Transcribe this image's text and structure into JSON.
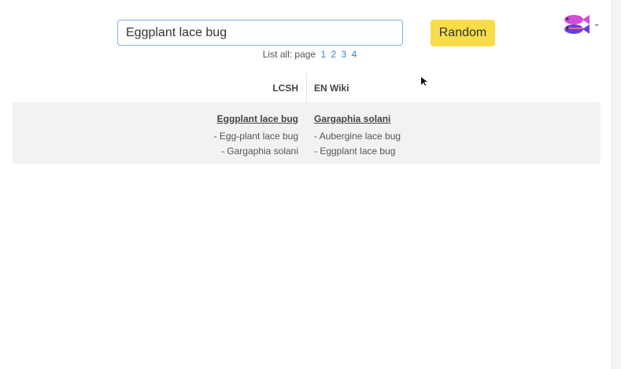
{
  "search": {
    "value": "Eggplant lace bug"
  },
  "random_button": "Random",
  "list_all": {
    "label": "List all: page",
    "pages": [
      "1",
      "2",
      "3",
      "4"
    ]
  },
  "table": {
    "headers": [
      "LCSH",
      "EN Wiki"
    ],
    "rows": [
      {
        "lcsh": {
          "title": "Eggplant lace bug",
          "alternates": [
            "- Egg-plant lace bug",
            "- Gargaphia solani"
          ]
        },
        "wiki": {
          "title": "Gargaphia solani",
          "alternates": [
            "- Aubergine lace bug",
            "- Eggplant lace bug"
          ]
        }
      }
    ]
  },
  "colors": {
    "accent_button": "#f7dd4a",
    "link": "#3b82c4",
    "row_background": "#f2f2f2"
  },
  "icons": {
    "avatar": "fish-avatar-icon",
    "menu": "chevron-down-icon"
  }
}
